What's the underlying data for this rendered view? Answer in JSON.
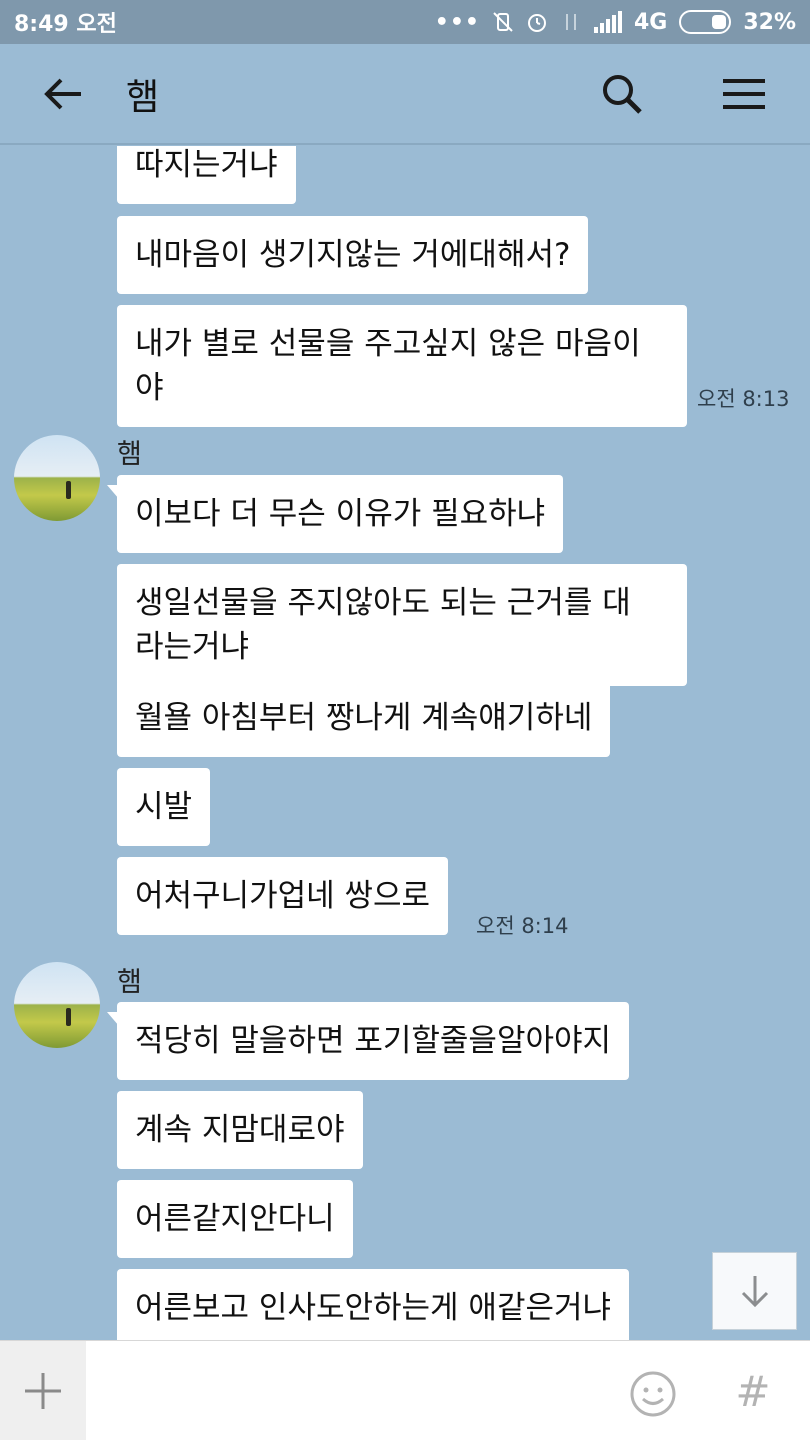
{
  "status_bar": {
    "time": "8:49 오전",
    "dots": "•••",
    "network": "4G",
    "battery": "32%"
  },
  "header": {
    "title": "햄",
    "back_icon": "arrow-left-icon",
    "search_icon": "search-icon",
    "menu_icon": "hamburger-menu-icon"
  },
  "chat": {
    "group1": {
      "messages": [
        "따지는거냐",
        "내마음이 생기지않는 거에대해서?",
        "내가 별로 선물을 주고싶지 않은 마음이\n야"
      ],
      "time": "오전 8:13"
    },
    "group2": {
      "sender": "햄",
      "messages": [
        "이보다 더 무슨 이유가 필요하냐",
        "생일선물을 주지않아도 되는 근거를 대\n라는거냐",
        "월욜 아침부터 짱나게 계속얘기하네",
        "시발",
        "어처구니가업네 쌍으로"
      ],
      "time": "오전 8:14"
    },
    "group3": {
      "sender": "햄",
      "messages": [
        "적당히 말을하면 포기할줄을알아야지",
        "계속 지맘대로야",
        "어른같지안다니",
        "어른보고 인사도안하는게 애같은거냐"
      ]
    }
  },
  "input_bar": {
    "placeholder": "",
    "hash_label": "#"
  },
  "colors": {
    "chat_background": "#9bbbd4",
    "status_bar": "#7f98ac",
    "bubble": "#ffffff"
  }
}
